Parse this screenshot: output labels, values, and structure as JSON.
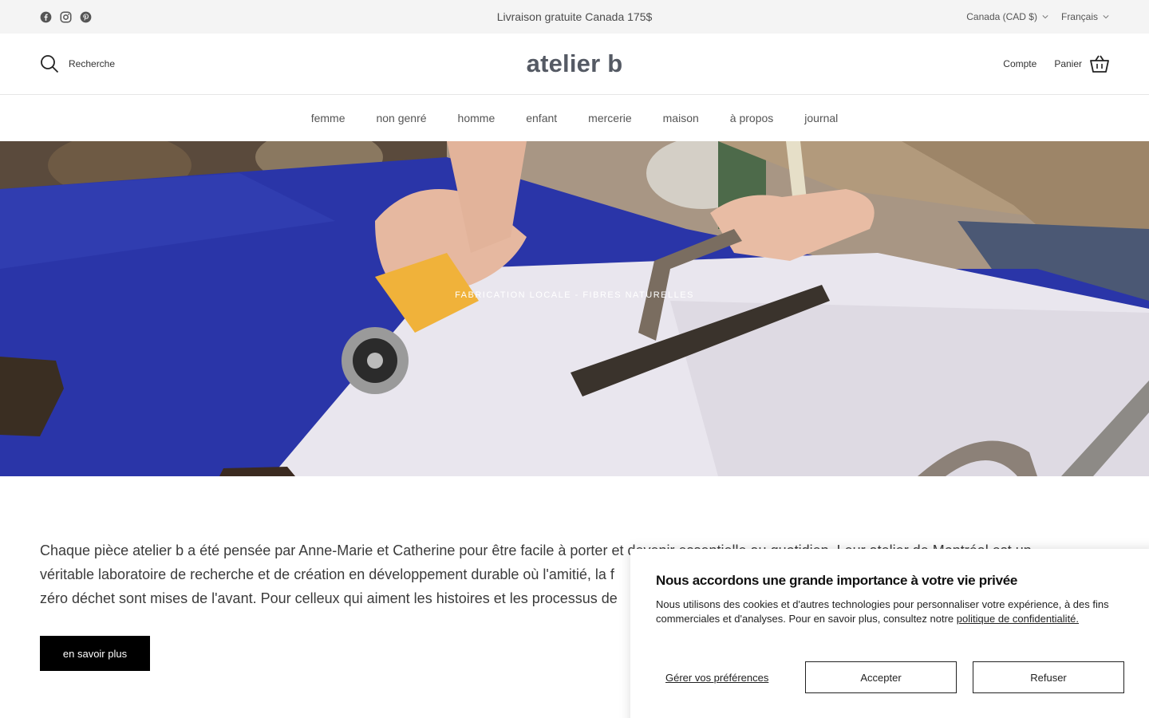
{
  "topbar": {
    "announcement": "Livraison gratuite Canada 175$",
    "country_selector": "Canada (CAD $)",
    "language_selector": "Français",
    "socials": [
      "facebook-icon",
      "instagram-icon",
      "pinterest-icon"
    ]
  },
  "header": {
    "logo": "atelier b",
    "search_label": "Recherche",
    "account_label": "Compte",
    "cart_label": "Panier"
  },
  "nav": {
    "items": [
      "femme",
      "non genré",
      "homme",
      "enfant",
      "mercerie",
      "maison",
      "à propos",
      "journal"
    ]
  },
  "hero": {
    "caption": "FABRICATION LOCALE - FIBRES NATURELLES"
  },
  "intro": {
    "line1": "Chaque pièce atelier b a été pensée par Anne-Marie et Catherine pour être facile à porter et devenir essentielle au quotidien. Leur atelier de Montréal est un",
    "line2": "véritable laboratoire de recherche et de création en développement durable où l'amitié, la f",
    "line3": "zéro déchet sont mises de l'avant. Pour celleux qui aiment les histoires et les processus de",
    "button_label": "en savoir plus"
  },
  "cookie_banner": {
    "title": "Nous accordons une grande importance à votre vie privée",
    "body": "Nous utilisons des cookies et d'autres technologies pour personnaliser votre expérience, à des fins commerciales et d'analyses. Pour en savoir plus, consultez notre",
    "policy_link": "politique de confidentialité.",
    "manage_label": "Gérer vos préférences",
    "accept_label": "Accepter",
    "decline_label": "Refuser"
  },
  "colors": {
    "topbar_bg": "#f4f4f4",
    "logo": "#555a64",
    "button_bg": "#000000",
    "fabric_blue": "#2a35a8"
  }
}
